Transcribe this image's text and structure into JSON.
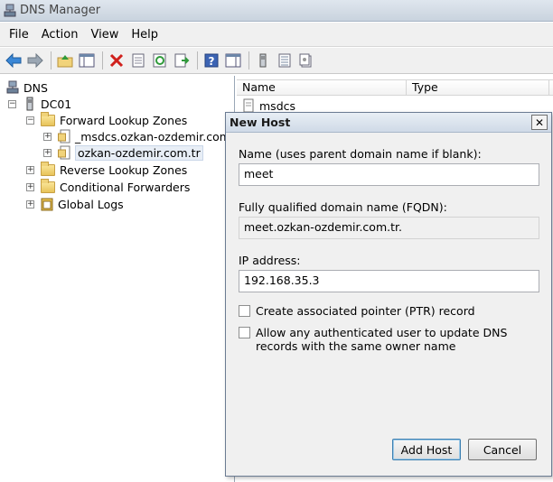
{
  "window": {
    "title": "DNS Manager"
  },
  "menu": [
    "File",
    "Action",
    "View",
    "Help"
  ],
  "toolbar": {
    "icons": [
      "back-icon",
      "forward-icon",
      "up-folder-icon",
      "show-hide-tree-icon",
      "delete-icon",
      "properties-icon",
      "refresh-icon",
      "export-list-icon",
      "help-icon",
      "action-pane-icon",
      "server-icon",
      "records-icon",
      "new-record-icon"
    ]
  },
  "tree": {
    "root": "DNS",
    "server": "DC01",
    "forward_zones": "Forward Lookup Zones",
    "zone_msdcs": "_msdcs.ozkan-ozdemir.com.tr",
    "zone_main": "ozkan-ozdemir.com.tr",
    "reverse_zones": "Reverse Lookup Zones",
    "conditional_forwarders": "Conditional Forwarders",
    "global_logs": "Global Logs"
  },
  "list": {
    "columns": [
      "Name",
      "Type"
    ],
    "rows": [
      {
        "name": "msdcs"
      }
    ]
  },
  "dialog": {
    "title": "New Host",
    "close_glyph": "✕",
    "name_label": "Name (uses parent domain name if blank):",
    "name_value": "meet",
    "fqdn_label": "Fully qualified domain name (FQDN):",
    "fqdn_value": "meet.ozkan-ozdemir.com.tr.",
    "ip_label": "IP address:",
    "ip_value": "192.168.35.3",
    "ptr_label": "Create associated pointer (PTR) record",
    "auth_label": "Allow any authenticated user to update DNS records with the same owner name",
    "add_host_label": "Add Host",
    "cancel_label": "Cancel"
  }
}
